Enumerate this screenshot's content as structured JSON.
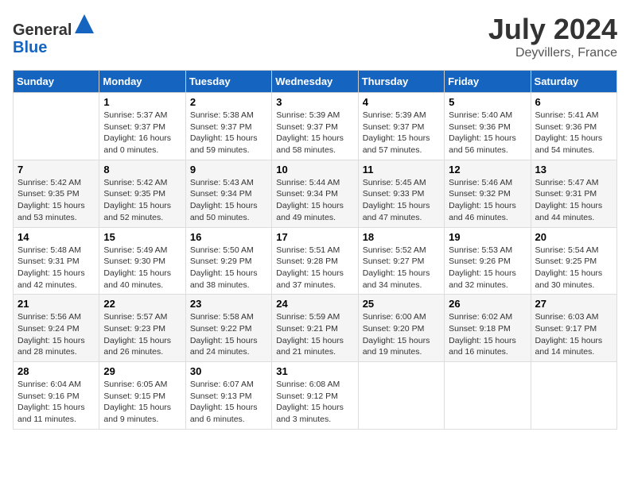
{
  "header": {
    "logo_general": "General",
    "logo_blue": "Blue",
    "month_title": "July 2024",
    "location": "Deyvillers, France"
  },
  "days_of_week": [
    "Sunday",
    "Monday",
    "Tuesday",
    "Wednesday",
    "Thursday",
    "Friday",
    "Saturday"
  ],
  "weeks": [
    [
      {
        "day": "",
        "info": ""
      },
      {
        "day": "1",
        "info": "Sunrise: 5:37 AM\nSunset: 9:37 PM\nDaylight: 16 hours\nand 0 minutes."
      },
      {
        "day": "2",
        "info": "Sunrise: 5:38 AM\nSunset: 9:37 PM\nDaylight: 15 hours\nand 59 minutes."
      },
      {
        "day": "3",
        "info": "Sunrise: 5:39 AM\nSunset: 9:37 PM\nDaylight: 15 hours\nand 58 minutes."
      },
      {
        "day": "4",
        "info": "Sunrise: 5:39 AM\nSunset: 9:37 PM\nDaylight: 15 hours\nand 57 minutes."
      },
      {
        "day": "5",
        "info": "Sunrise: 5:40 AM\nSunset: 9:36 PM\nDaylight: 15 hours\nand 56 minutes."
      },
      {
        "day": "6",
        "info": "Sunrise: 5:41 AM\nSunset: 9:36 PM\nDaylight: 15 hours\nand 54 minutes."
      }
    ],
    [
      {
        "day": "7",
        "info": "Sunrise: 5:42 AM\nSunset: 9:35 PM\nDaylight: 15 hours\nand 53 minutes."
      },
      {
        "day": "8",
        "info": "Sunrise: 5:42 AM\nSunset: 9:35 PM\nDaylight: 15 hours\nand 52 minutes."
      },
      {
        "day": "9",
        "info": "Sunrise: 5:43 AM\nSunset: 9:34 PM\nDaylight: 15 hours\nand 50 minutes."
      },
      {
        "day": "10",
        "info": "Sunrise: 5:44 AM\nSunset: 9:34 PM\nDaylight: 15 hours\nand 49 minutes."
      },
      {
        "day": "11",
        "info": "Sunrise: 5:45 AM\nSunset: 9:33 PM\nDaylight: 15 hours\nand 47 minutes."
      },
      {
        "day": "12",
        "info": "Sunrise: 5:46 AM\nSunset: 9:32 PM\nDaylight: 15 hours\nand 46 minutes."
      },
      {
        "day": "13",
        "info": "Sunrise: 5:47 AM\nSunset: 9:31 PM\nDaylight: 15 hours\nand 44 minutes."
      }
    ],
    [
      {
        "day": "14",
        "info": "Sunrise: 5:48 AM\nSunset: 9:31 PM\nDaylight: 15 hours\nand 42 minutes."
      },
      {
        "day": "15",
        "info": "Sunrise: 5:49 AM\nSunset: 9:30 PM\nDaylight: 15 hours\nand 40 minutes."
      },
      {
        "day": "16",
        "info": "Sunrise: 5:50 AM\nSunset: 9:29 PM\nDaylight: 15 hours\nand 38 minutes."
      },
      {
        "day": "17",
        "info": "Sunrise: 5:51 AM\nSunset: 9:28 PM\nDaylight: 15 hours\nand 37 minutes."
      },
      {
        "day": "18",
        "info": "Sunrise: 5:52 AM\nSunset: 9:27 PM\nDaylight: 15 hours\nand 34 minutes."
      },
      {
        "day": "19",
        "info": "Sunrise: 5:53 AM\nSunset: 9:26 PM\nDaylight: 15 hours\nand 32 minutes."
      },
      {
        "day": "20",
        "info": "Sunrise: 5:54 AM\nSunset: 9:25 PM\nDaylight: 15 hours\nand 30 minutes."
      }
    ],
    [
      {
        "day": "21",
        "info": "Sunrise: 5:56 AM\nSunset: 9:24 PM\nDaylight: 15 hours\nand 28 minutes."
      },
      {
        "day": "22",
        "info": "Sunrise: 5:57 AM\nSunset: 9:23 PM\nDaylight: 15 hours\nand 26 minutes."
      },
      {
        "day": "23",
        "info": "Sunrise: 5:58 AM\nSunset: 9:22 PM\nDaylight: 15 hours\nand 24 minutes."
      },
      {
        "day": "24",
        "info": "Sunrise: 5:59 AM\nSunset: 9:21 PM\nDaylight: 15 hours\nand 21 minutes."
      },
      {
        "day": "25",
        "info": "Sunrise: 6:00 AM\nSunset: 9:20 PM\nDaylight: 15 hours\nand 19 minutes."
      },
      {
        "day": "26",
        "info": "Sunrise: 6:02 AM\nSunset: 9:18 PM\nDaylight: 15 hours\nand 16 minutes."
      },
      {
        "day": "27",
        "info": "Sunrise: 6:03 AM\nSunset: 9:17 PM\nDaylight: 15 hours\nand 14 minutes."
      }
    ],
    [
      {
        "day": "28",
        "info": "Sunrise: 6:04 AM\nSunset: 9:16 PM\nDaylight: 15 hours\nand 11 minutes."
      },
      {
        "day": "29",
        "info": "Sunrise: 6:05 AM\nSunset: 9:15 PM\nDaylight: 15 hours\nand 9 minutes."
      },
      {
        "day": "30",
        "info": "Sunrise: 6:07 AM\nSunset: 9:13 PM\nDaylight: 15 hours\nand 6 minutes."
      },
      {
        "day": "31",
        "info": "Sunrise: 6:08 AM\nSunset: 9:12 PM\nDaylight: 15 hours\nand 3 minutes."
      },
      {
        "day": "",
        "info": ""
      },
      {
        "day": "",
        "info": ""
      },
      {
        "day": "",
        "info": ""
      }
    ]
  ]
}
